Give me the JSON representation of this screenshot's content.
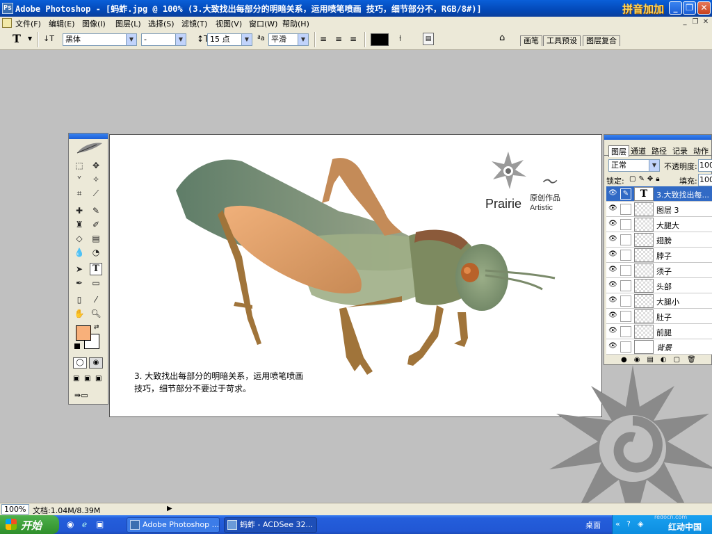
{
  "window": {
    "title": "Adobe Photoshop - [蚂蚱.jpg @ 100% (3.大致找出每部分的明暗关系，运用喷笔喷画 技巧，细节部分不，RGB/8#)]",
    "brand": "拼音加加",
    "minimize": "_",
    "restore": "❐",
    "close": "✕"
  },
  "menu": {
    "items": [
      "文件(F)",
      "编辑(E)",
      "图像(I)",
      "图层(L)",
      "选择(S)",
      "滤镜(T)",
      "视图(V)",
      "窗口(W)",
      "帮助(H)"
    ]
  },
  "options": {
    "font_family": "黑体",
    "font_style": "-",
    "font_size": "15 点",
    "antialias_prefix": "ªa",
    "antialias": "平滑",
    "tabs": [
      "画笔",
      "工具预设",
      "图层复合"
    ]
  },
  "canvas": {
    "caption_line1": "3. 大致找出每部分的明暗关系，运用喷笔喷画",
    "caption_line2": "技巧，细节部分不要过于苛求。",
    "logo_prairie": "Prairie",
    "logo_artistic": "Artistic",
    "logo_original": "原创作品"
  },
  "layers_panel": {
    "tabs": [
      "图层",
      "通道",
      "路径",
      "记录",
      "动作"
    ],
    "blend_mode": "正常",
    "opacity_label": "不透明度:",
    "opacity_value": "100",
    "lock_label": "锁定:",
    "fill_label": "填充:",
    "fill_value": "100",
    "layers": [
      {
        "name": "3.大致找出每...",
        "type": "text",
        "active": true
      },
      {
        "name": "图层 3",
        "type": "pixel"
      },
      {
        "name": "大腿大",
        "type": "pixel"
      },
      {
        "name": "翅膀",
        "type": "pixel"
      },
      {
        "name": "脖子",
        "type": "pixel"
      },
      {
        "name": "须子",
        "type": "pixel"
      },
      {
        "name": "头部",
        "type": "pixel"
      },
      {
        "name": "大腿小",
        "type": "pixel"
      },
      {
        "name": "肚子",
        "type": "pixel"
      },
      {
        "name": "前腿",
        "type": "pixel"
      },
      {
        "name": "背景",
        "type": "background"
      }
    ]
  },
  "status": {
    "zoom": "100%",
    "doc_info": "文档:1.04M/8.39M"
  },
  "taskbar": {
    "start": "开始",
    "tasks": [
      "Adobe Photoshop ...",
      "蚂蚱 - ACDSee 32..."
    ],
    "tray_text": "桌面",
    "watermark": "红动中国",
    "watermark_url": "redocn.com"
  },
  "colors": {
    "foreground": "#f8b07a",
    "background": "#ffffff",
    "text_color_swatch": "#000000",
    "grasshopper_wing": "#6f8a72",
    "grasshopper_leg": "#a0743a"
  }
}
